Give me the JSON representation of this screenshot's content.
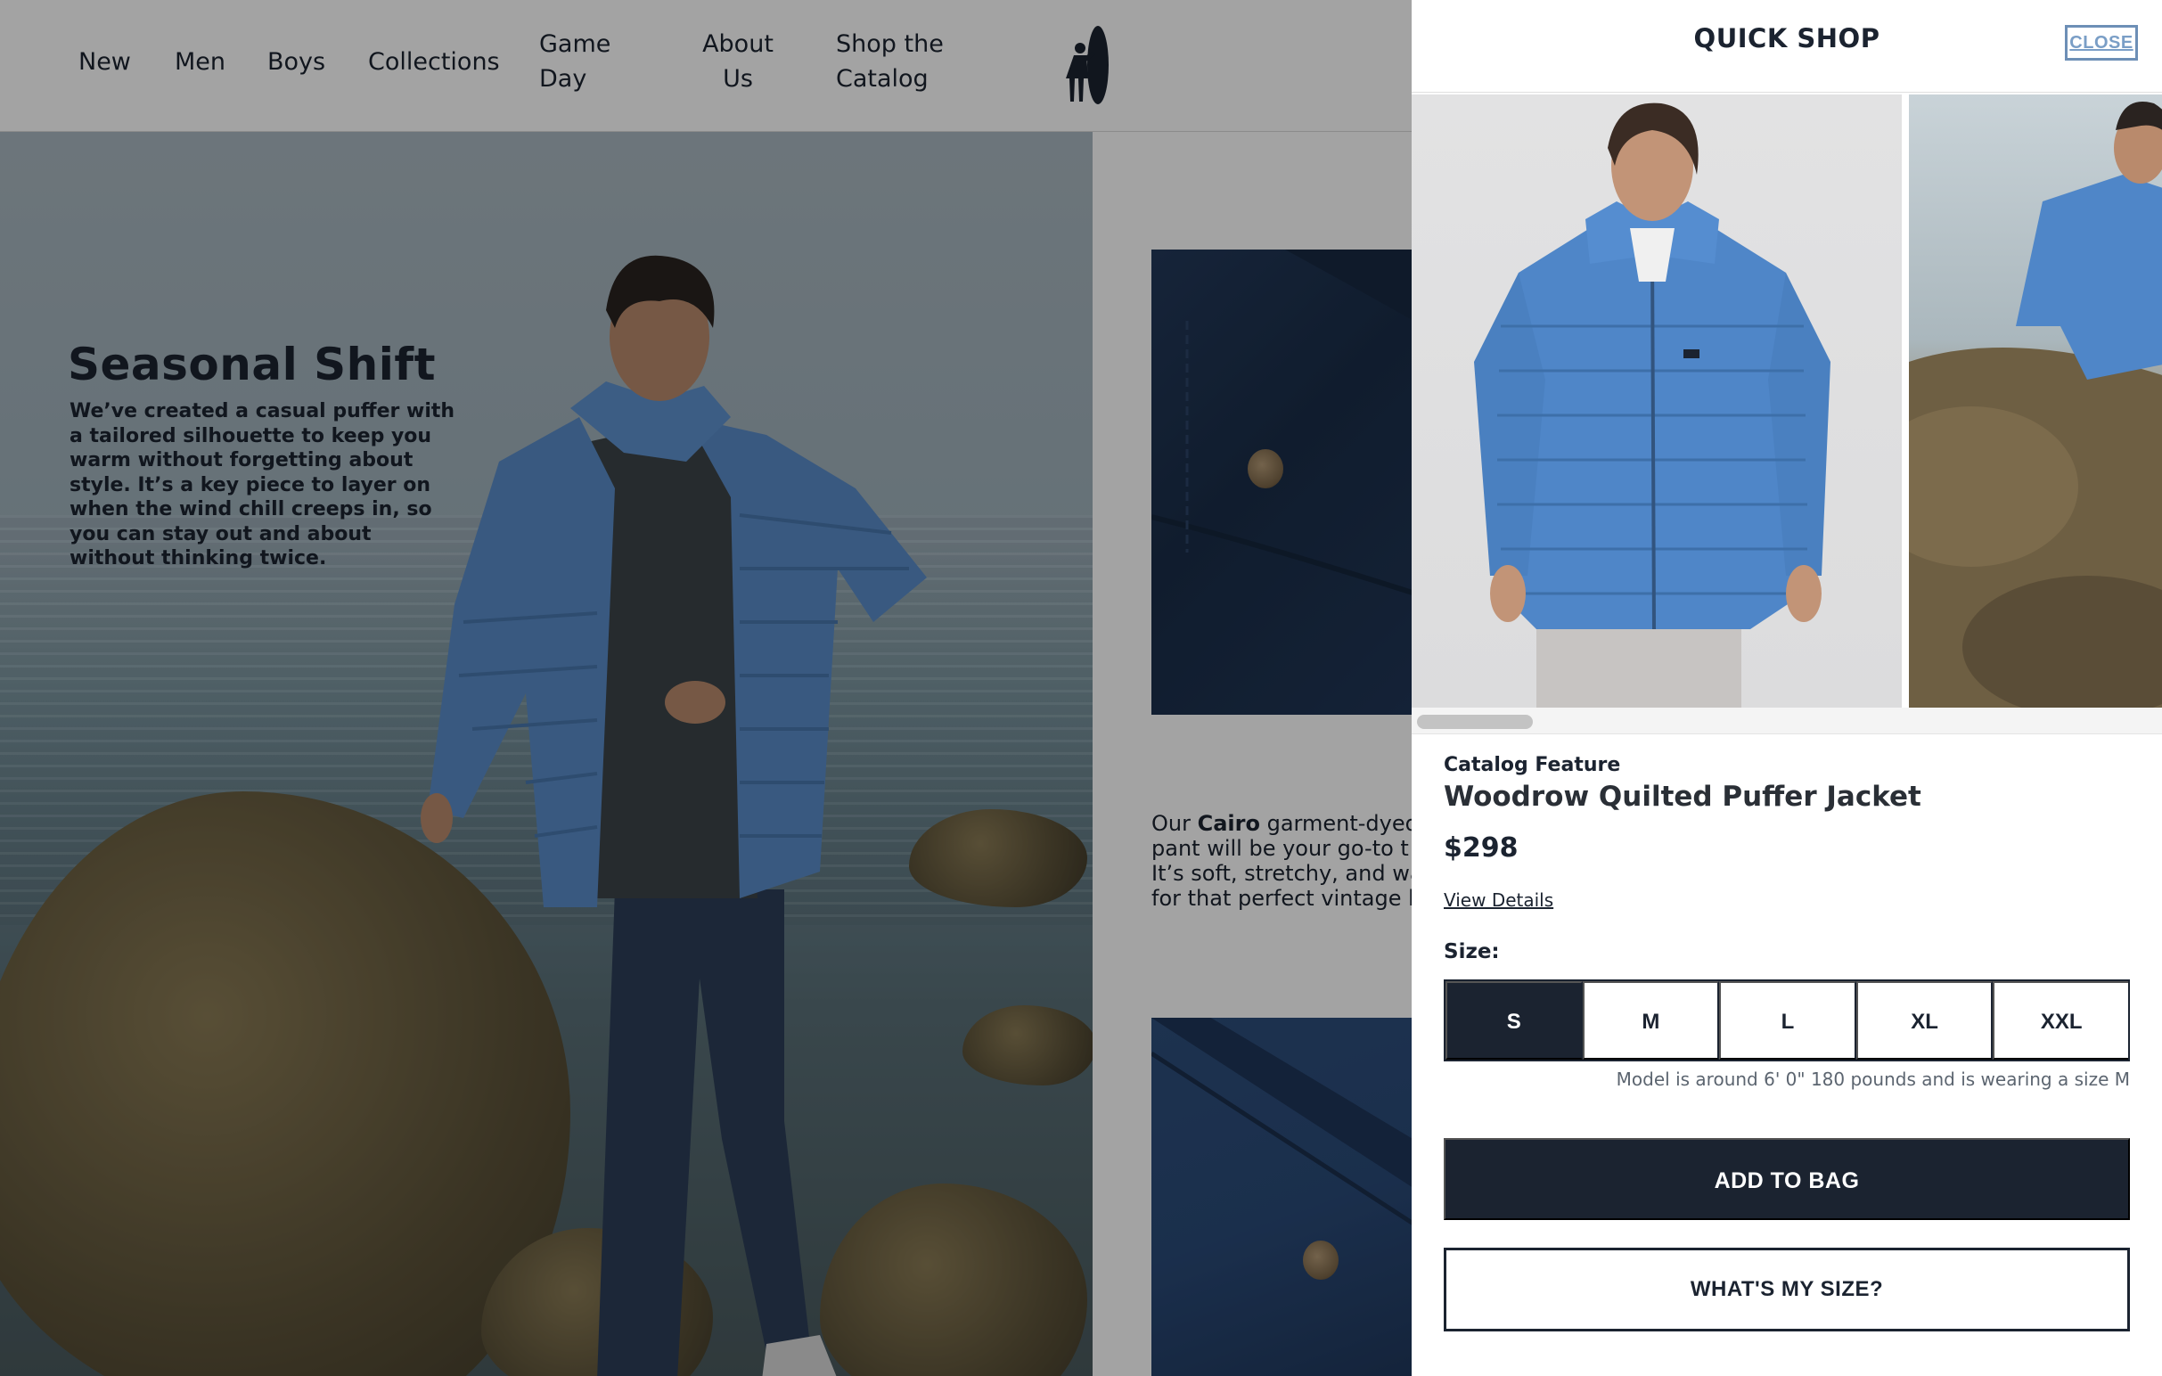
{
  "nav": {
    "items": [
      {
        "label": "New"
      },
      {
        "label": "Men"
      },
      {
        "label": "Boys"
      },
      {
        "label": "Collections"
      },
      {
        "label": "Game Day"
      },
      {
        "label": "About Us"
      },
      {
        "label": "Shop the Catalog"
      }
    ],
    "logo_icon": "surfer-with-board-logo"
  },
  "hero": {
    "title": "Seasonal Shift",
    "body": "We’ve created a casual puffer with a tailored silhouette to keep you warm without forgetting about style. It’s a key piece to layer on when the wind chill creeps in, so you can stay out and about without thinking twice."
  },
  "secondary": {
    "text_prefix": "Our ",
    "text_bold": "Cairo",
    "text_rest": " garment-dyed\npant will be your go-to t\nIt’s soft, stretchy, and wa\nfor that perfect vintage l"
  },
  "quick_shop": {
    "title": "QUICK SHOP",
    "close_label": "CLOSE",
    "category": "Catalog Feature",
    "product_name": "Woodrow Quilted Puffer Jacket",
    "price": "$298",
    "view_details": "View Details",
    "size_label": "Size:",
    "sizes": [
      {
        "label": "S",
        "selected": true
      },
      {
        "label": "M",
        "selected": false
      },
      {
        "label": "L",
        "selected": false
      },
      {
        "label": "XL",
        "selected": false
      },
      {
        "label": "XXL",
        "selected": false
      }
    ],
    "model_note": "Model is around 6' 0\" 180 pounds and is wearing a size M",
    "add_to_bag": "ADD TO BAG",
    "whats_my_size": "WHAT'S MY SIZE?"
  },
  "colors": {
    "navy": "#1b2330",
    "jacket_blue": "#4d82c2",
    "close_link": "#7a9ec6"
  }
}
